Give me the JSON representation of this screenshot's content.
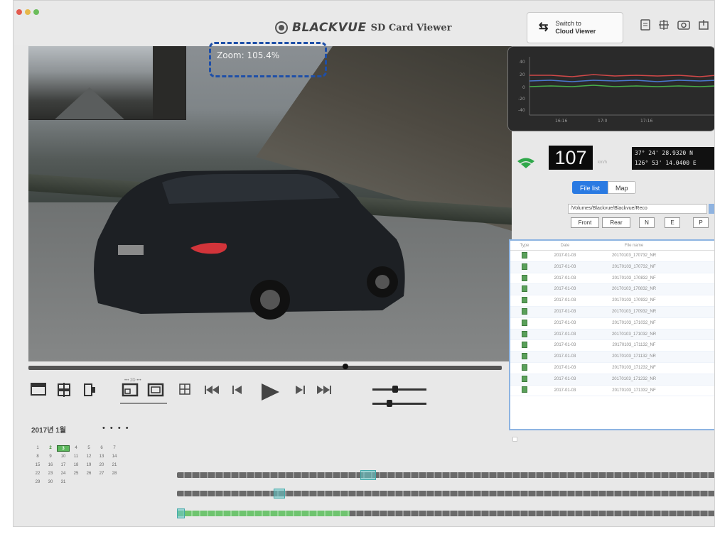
{
  "window": {
    "brand": "BLACKVUE",
    "app_name": "SD Card Viewer",
    "switch_button": {
      "line1": "Switch to",
      "line2": "Cloud Viewer"
    },
    "toolbar_icons": [
      "document-icon",
      "settings-icon",
      "camera-icon"
    ]
  },
  "video": {
    "zoom_text": "Zoom: 105.4%",
    "seek_position": 0.67
  },
  "controls": {
    "view_mode_label": "••• 2D •••",
    "icons": [
      "fullscreen-icon",
      "split-view-icon",
      "pip-icon",
      "front-view-icon",
      "rear-view-icon",
      "grid-icon",
      "skip-start-icon",
      "prev-frame-icon",
      "play-icon",
      "next-frame-icon",
      "skip-end-icon"
    ]
  },
  "calendar": {
    "title": "2017년 1월",
    "nav_dots": "• • • •",
    "rows": [
      [
        "",
        "",
        "",
        "",
        "",
        "",
        ""
      ],
      [
        "1",
        "2",
        "3",
        "4",
        "5",
        "6",
        "7"
      ],
      [
        "8",
        "9",
        "10",
        "11",
        "12",
        "13",
        "14"
      ],
      [
        "15",
        "16",
        "17",
        "18",
        "19",
        "20",
        "21"
      ],
      [
        "22",
        "23",
        "24",
        "25",
        "26",
        "27",
        "28"
      ],
      [
        "29",
        "30",
        "31",
        "",
        "",
        "",
        ""
      ]
    ],
    "highlighted_days": [
      "2",
      "3"
    ],
    "selected_day": "3"
  },
  "timeline": {
    "rows": [
      {
        "fill_start": 0.0,
        "fill_end": 0.0,
        "marker_start": 0.34,
        "marker_end": 0.37
      },
      {
        "fill_start": 0.0,
        "fill_end": 0.0,
        "marker_start": 0.18,
        "marker_end": 0.2
      },
      {
        "fill_start": 0.0,
        "fill_end": 0.32,
        "marker_start": 0.0,
        "marker_end": 0.015
      }
    ]
  },
  "sensor_graph": {
    "y_labels": [
      "40",
      "20",
      "0",
      "-20",
      "-40"
    ],
    "x_labels": [
      "16:16",
      "17:0",
      "17:16"
    ]
  },
  "speed": {
    "value": "107",
    "unit": "km/h"
  },
  "gps": {
    "lat": "37° 24' 28.9320 N",
    "lon": "126° 53' 14.0400 E"
  },
  "tabs": {
    "file_list": "File list",
    "map": "Map"
  },
  "path": {
    "value": "/Volumes/Blackvue/Blackvue/Reco"
  },
  "filters": {
    "front": "Front",
    "rear": "Rear",
    "n": "N",
    "e": "E",
    "p": "P"
  },
  "file_table": {
    "headers": {
      "type": "Type",
      "date": "Date",
      "name": "File name"
    },
    "rows": [
      {
        "date": "2017-01-03",
        "name": "20170103_170732_NR"
      },
      {
        "date": "2017-01-03",
        "name": "20170103_170732_NF"
      },
      {
        "date": "2017-01-03",
        "name": "20170103_170832_NF"
      },
      {
        "date": "2017-01-03",
        "name": "20170103_170832_NR"
      },
      {
        "date": "2017-01-03",
        "name": "20170103_170932_NF"
      },
      {
        "date": "2017-01-03",
        "name": "20170103_170932_NR"
      },
      {
        "date": "2017-01-03",
        "name": "20170103_171032_NF"
      },
      {
        "date": "2017-01-03",
        "name": "20170103_171032_NR"
      },
      {
        "date": "2017-01-03",
        "name": "20170103_171132_NF"
      },
      {
        "date": "2017-01-03",
        "name": "20170103_171132_NR"
      },
      {
        "date": "2017-01-03",
        "name": "20170103_171232_NF"
      },
      {
        "date": "2017-01-03",
        "name": "20170103_171232_NR"
      },
      {
        "date": "2017-01-03",
        "name": "20170103_171332_NF"
      }
    ]
  },
  "colors": {
    "accent": "#2a7ae2",
    "highlight_border": "#1e4fa8",
    "recording_green": "#5cb85c"
  }
}
